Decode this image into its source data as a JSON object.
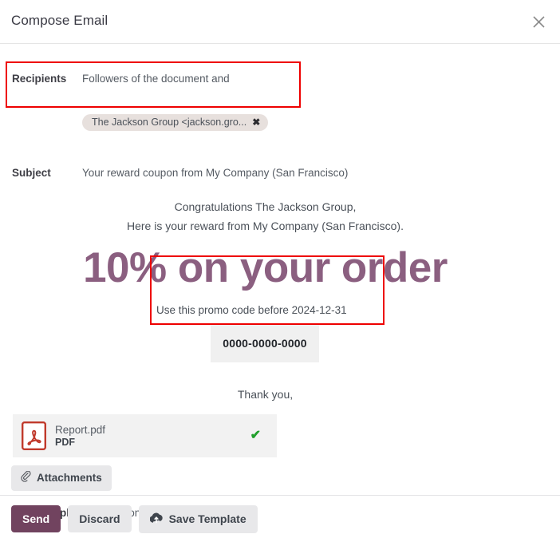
{
  "dialog": {
    "title": "Compose Email",
    "close_icon": "close-icon"
  },
  "fields": {
    "recipients_label": "Recipients",
    "recipients_value": "Followers of the document and",
    "recipient_chip": "The Jackson Group <jackson.gro...",
    "chip_remove_icon": "✖",
    "subject_label": "Subject",
    "subject_value": "Your reward coupon from My Company (San Francisco)"
  },
  "email_preview": {
    "greeting_line_1": "Congratulations The Jackson Group,",
    "greeting_line_2": "Here is your reward from My Company (San Francisco).",
    "headline": "10% on your order",
    "promo_instruction": "Use this promo code before 2024-12-31",
    "promo_code": "0000-0000-0000",
    "closing": "Thank you,"
  },
  "attachment": {
    "file_name": "Report.pdf",
    "file_type": "PDF",
    "status_icon": "✔",
    "pdf_icon": "pdf-file-icon",
    "attachments_button": "Attachments",
    "paperclip_icon": "paperclip-icon"
  },
  "template": {
    "load_label": "Load template",
    "selected": "Coupon: Coupon Information"
  },
  "footer": {
    "send": "Send",
    "discard": "Discard",
    "save_template": "Save Template",
    "cloud_icon": "cloud-upload-icon"
  },
  "colors": {
    "accent_headline": "#8b5f80",
    "primary_button": "#71435f",
    "annotation": "#ee0000",
    "success": "#22a02c",
    "pdf_red": "#c0392b"
  }
}
